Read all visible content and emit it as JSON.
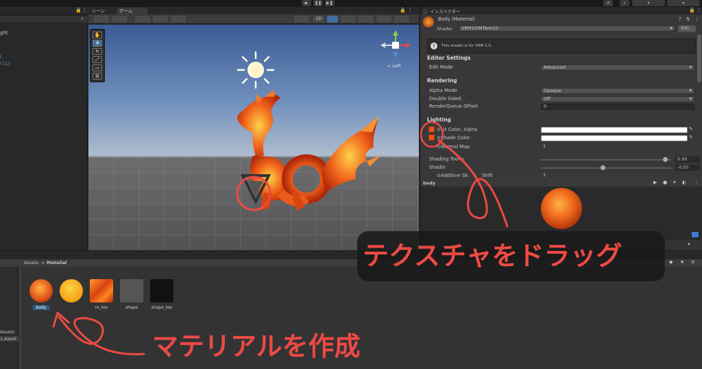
{
  "scene_view": {
    "tab_scene": "シーン",
    "tab_game": "ゲーム",
    "button_2d": "2D",
    "gizmo_label": "< Left"
  },
  "hierarchy": {
    "items": [
      "ght",
      "I",
      "I (1)"
    ]
  },
  "inspector": {
    "tab": "インスペクター",
    "material_name": "Body (Material)",
    "shader_label": "Shader",
    "shader_value": "VRM10/MToon10",
    "edit_button": "Edit...",
    "info_message": "This shader is for VRM 1.0.",
    "editor_settings_header": "Editor Settings",
    "edit_mode_label": "Edit Mode",
    "edit_mode_value": "Advanced",
    "rendering_header": "Rendering",
    "alpha_mode_label": "Alpha Mode",
    "alpha_mode_value": "Opaque",
    "double_sided_label": "Double Sided",
    "double_sided_value": "Off",
    "render_queue_label": "RenderQueue Offset",
    "render_queue_value": "0",
    "lighting_header": "Lighting",
    "lit_color_label": "Lit Color, Alpha",
    "shade_color_label": "Shade Color",
    "normal_map_label": "Normal Map",
    "normal_map_value": "1",
    "shading_toony_label": "Shading Toony",
    "shading_toony_value": "0.95",
    "shading_toony_level": 0.95,
    "shading_shift_label": "Shadin",
    "shading_shift_value": "-0.05",
    "shading_shift_level": 0.475,
    "additive_shift_label": "Additive Sh",
    "additive_shift_label_tail": "Shift",
    "additive_shift_value": "1"
  },
  "preview": {
    "name": "body"
  },
  "project": {
    "breadcrumb_root": "Assets",
    "breadcrumb_sep": ">",
    "breadcrumb_current": "Matelial",
    "left_items": [
      "Assets",
      "1.Asset"
    ],
    "assets": [
      {
        "name": "body",
        "selected": true
      },
      {
        "name": "",
        "selected": false
      },
      {
        "name": "re_tex",
        "selected": false
      },
      {
        "name": "shape",
        "selected": false
      },
      {
        "name": "shape_tex",
        "selected": false
      }
    ]
  },
  "annotations": {
    "drag_texture": "テクスチャをドラッグ",
    "create_material": "マテリアルを作成"
  },
  "colors": {
    "annotation_red": "#ee4a45",
    "selection_blue": "#2c5d87",
    "fire_orange": "#e8531c"
  }
}
